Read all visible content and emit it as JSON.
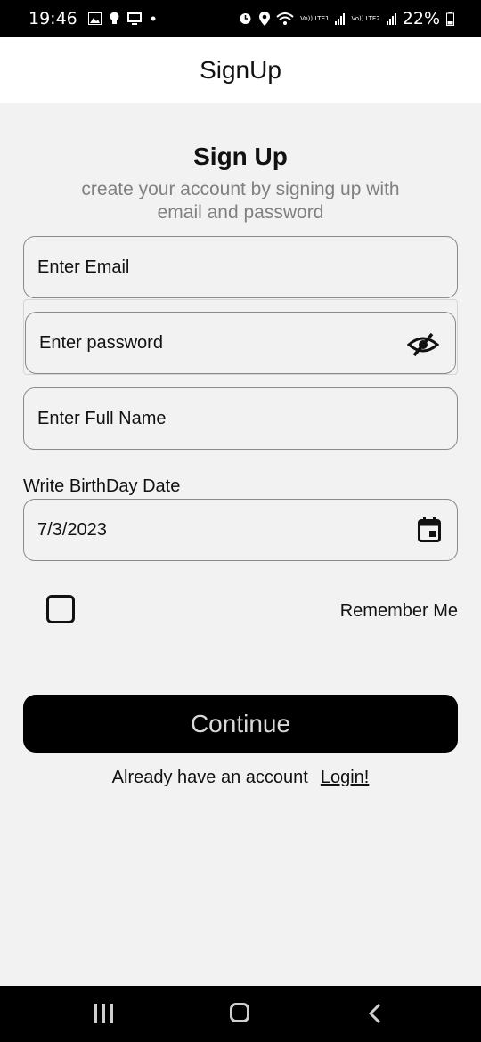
{
  "status_bar": {
    "time": "19:46",
    "battery": "22%",
    "lte1": "Vo)) LTE1",
    "lte2": "Vo)) LTE2",
    "icons": [
      "gallery-icon",
      "bulb-icon",
      "screen-icon",
      "dot-icon",
      "alarm-icon",
      "location-icon",
      "wifi-icon",
      "signal-icon",
      "battery-icon"
    ]
  },
  "app_bar": {
    "title": "SignUp"
  },
  "header": {
    "title": "Sign Up",
    "subtitle": "create your account by signing up with email and password"
  },
  "form": {
    "email_placeholder": "Enter Email",
    "password_placeholder": "Enter password",
    "fullname_placeholder": "Enter Full Name",
    "birthday_label": "Write BirthDay Date",
    "birthday_value": "7/3/2023",
    "remember_label": "Remember Me",
    "remember_checked": false,
    "continue_label": "Continue"
  },
  "footer": {
    "prompt": "Already have an account",
    "login_link": "Login!"
  },
  "colors": {
    "background": "#f2f2f2",
    "button": "#000000",
    "button_text": "#d9d9d9",
    "subtitle": "#808080"
  }
}
